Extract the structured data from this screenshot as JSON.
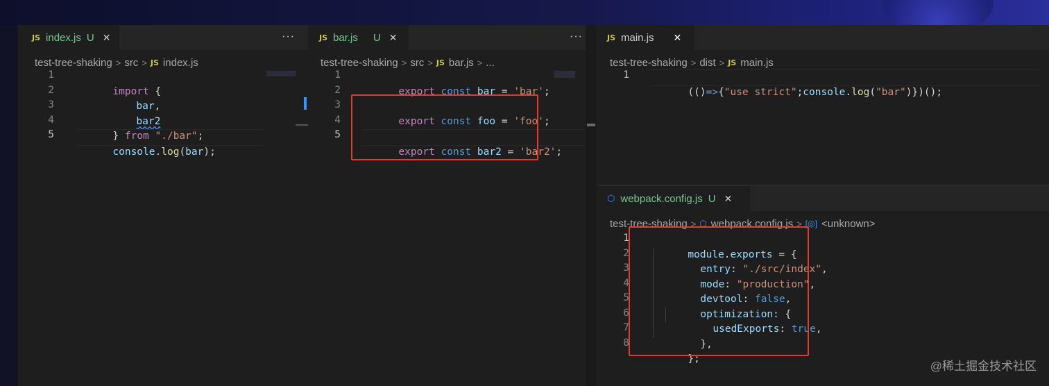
{
  "panes": {
    "left": {
      "tab": {
        "icon": "JS",
        "name": "index.js",
        "status": "U",
        "close": "✕"
      },
      "more": "···",
      "breadcrumb": [
        "test-tree-shaking",
        "src",
        "index.js"
      ],
      "line_numbers": [
        "1",
        "2",
        "3",
        "4",
        "5"
      ],
      "code": {
        "l1_kw": "import",
        "l1_p": " {",
        "l2_v": "bar",
        "l2_p": ",",
        "l3_v": "bar2",
        "l4_p1": "} ",
        "l4_kw": "from",
        "l4_s": "\"./bar\"",
        "l4_p2": ";",
        "l5_v1": "console",
        "l5_p1": ".",
        "l5_f": "log",
        "l5_p2": "(",
        "l5_v2": "bar",
        "l5_p3": ");"
      }
    },
    "middle": {
      "tab": {
        "icon": "JS",
        "name": "bar.js",
        "status": "U",
        "close": "✕"
      },
      "more": "···",
      "breadcrumb": [
        "test-tree-shaking",
        "src",
        "bar.js",
        "..."
      ],
      "line_numbers": [
        "1",
        "2",
        "3",
        "4",
        "5"
      ],
      "code": {
        "kw": "export",
        "st": "const",
        "l1_v": "bar",
        "l1_eq": " = ",
        "l1_s": "'bar'",
        "semi": ";",
        "l3_v": "foo",
        "l3_s": "'foo'",
        "l5_v": "bar2",
        "l5_s": "'bar2'"
      }
    },
    "right_top": {
      "tab": {
        "icon": "JS",
        "name": "main.js",
        "close": "✕"
      },
      "breadcrumb": [
        "test-tree-shaking",
        "dist",
        "main.js"
      ],
      "line_numbers": [
        "1"
      ],
      "code": {
        "p1": "(()",
        "arrow": "=>",
        "p2": "{",
        "s1": "\"use strict\"",
        "p3": ";",
        "v1": "console",
        "p4": ".",
        "f": "log",
        "p5": "(",
        "s2": "\"bar\"",
        "p6": ")})();"
      }
    },
    "right_bottom": {
      "tab": {
        "icon": "webpack-icon",
        "name": "webpack.config.js",
        "status": "U",
        "close": "✕"
      },
      "breadcrumb": [
        "test-tree-shaking",
        "webpack.config.js",
        "<unknown>"
      ],
      "line_numbers": [
        "1",
        "2",
        "3",
        "4",
        "5",
        "6",
        "7",
        "8"
      ],
      "code": {
        "l1_v1": "module",
        "l1_p1": ".",
        "l1_v2": "exports",
        "l1_p2": " = {",
        "l2_k": "entry",
        "l2_s": "\"./src/index\"",
        "l3_k": "mode",
        "l3_s": "\"production\"",
        "l4_k": "devtool",
        "l4_c": "false",
        "l5_k": "optimization",
        "l5_p": ": {",
        "l6_k": "usedExports",
        "l6_c": "true",
        "l7_p": "},",
        "l8_p": "};",
        "colon": ": ",
        "comma": ","
      }
    }
  },
  "watermark": "@稀土掘金技术社区",
  "colors": {
    "highlight_box": "#e53b2e",
    "keyword": "#c586c0",
    "string": "#ce9178",
    "storage": "#569cd6",
    "variable": "#9cdcfe"
  }
}
